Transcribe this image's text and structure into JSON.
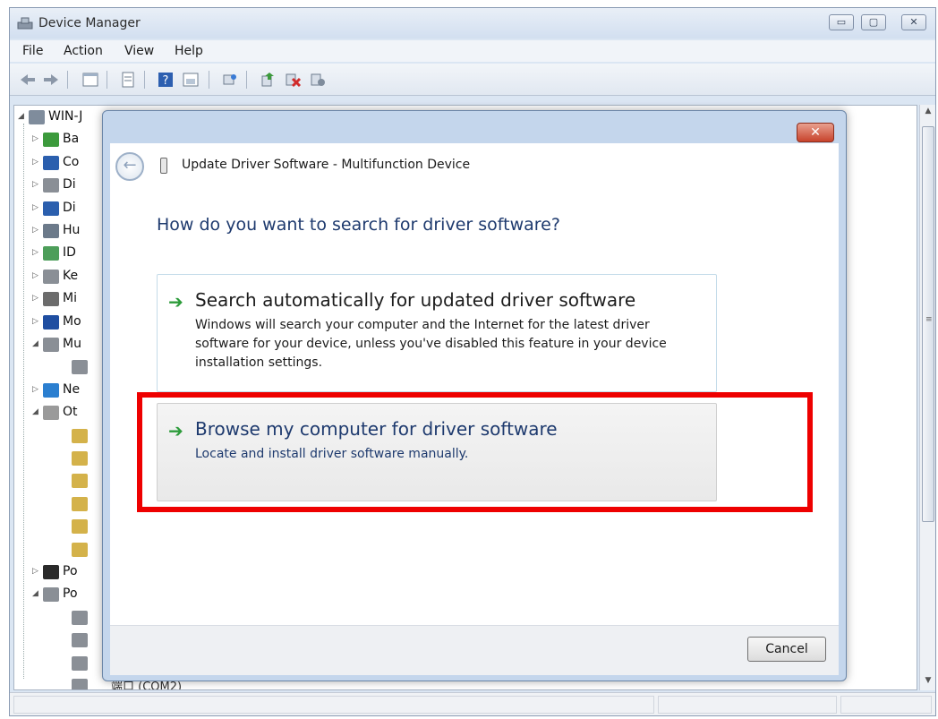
{
  "window": {
    "title": "Device Manager",
    "controls": {
      "minimize_icon": "minimize-icon",
      "maximize_icon": "maximize-icon",
      "close_icon": "close-icon"
    }
  },
  "menubar": {
    "items": [
      "File",
      "Action",
      "View",
      "Help"
    ]
  },
  "toolbar": {
    "icons": [
      "back-arrow-icon",
      "forward-arrow-icon",
      "console-tree-icon",
      "properties-icon",
      "help-icon",
      "view-icon",
      "scan-hardware-icon",
      "update-driver-icon",
      "uninstall-icon",
      "disable-device-icon"
    ]
  },
  "tree": {
    "rows": [
      {
        "expander": "◢",
        "label": "WIN-J",
        "icon_color": "#7f8c9c"
      },
      {
        "expander": "▷",
        "label": "Ba",
        "icon_color": "#3c9a3c"
      },
      {
        "expander": "▷",
        "label": "Co",
        "icon_color": "#2b5fae"
      },
      {
        "expander": "▷",
        "label": "Di",
        "icon_color": "#8a8f96"
      },
      {
        "expander": "▷",
        "label": "Di",
        "icon_color": "#2b5fae"
      },
      {
        "expander": "▷",
        "label": "Hu",
        "icon_color": "#6c7a8a"
      },
      {
        "expander": "▷",
        "label": "ID",
        "icon_color": "#4d9e5a"
      },
      {
        "expander": "▷",
        "label": "Ke",
        "icon_color": "#8a8f96"
      },
      {
        "expander": "▷",
        "label": "Mi",
        "icon_color": "#6c6c6c"
      },
      {
        "expander": "▷",
        "label": "Mo",
        "icon_color": "#1f4ea1"
      },
      {
        "expander": "◢",
        "label": "Mu",
        "icon_color": "#8a8f96"
      },
      {
        "expander": "",
        "label": "",
        "icon_color": "#8a8f96"
      },
      {
        "expander": "▷",
        "label": "Ne",
        "icon_color": "#2b7fd0"
      },
      {
        "expander": "◢",
        "label": "Ot",
        "icon_color": "#9a9a9a"
      },
      {
        "expander": "",
        "label": "",
        "icon_color": "#d4b24a"
      },
      {
        "expander": "",
        "label": "",
        "icon_color": "#d4b24a"
      },
      {
        "expander": "",
        "label": "",
        "icon_color": "#d4b24a"
      },
      {
        "expander": "",
        "label": "",
        "icon_color": "#d4b24a"
      },
      {
        "expander": "",
        "label": "",
        "icon_color": "#d4b24a"
      },
      {
        "expander": "",
        "label": "",
        "icon_color": "#d4b24a"
      },
      {
        "expander": "▷",
        "label": "Po",
        "icon_color": "#2a2a2a"
      },
      {
        "expander": "◢",
        "label": "Po",
        "icon_color": "#8a8f96"
      },
      {
        "expander": "",
        "label": "",
        "icon_color": "#8a8f96"
      },
      {
        "expander": "",
        "label": "",
        "icon_color": "#8a8f96"
      },
      {
        "expander": "",
        "label": "",
        "icon_color": "#8a8f96"
      },
      {
        "expander": "",
        "label": "",
        "icon_color": "#8a8f96"
      }
    ],
    "bottom_partial_text": "端口 (COM2)"
  },
  "dialog": {
    "title": "Update Driver Software - Multifunction Device",
    "close_label": "✕",
    "question": "How do you want to search for driver software?",
    "options": [
      {
        "title": "Search automatically for updated driver software",
        "description": "Windows will search your computer and the Internet for the latest driver software for your device, unless you've disabled this feature in your device installation settings."
      },
      {
        "title": "Browse my computer for driver software",
        "description": "Locate and install driver software manually."
      }
    ],
    "cancel_label": "Cancel",
    "highlight_color": "#ee0000",
    "accent_color": "#1e3a6e"
  }
}
